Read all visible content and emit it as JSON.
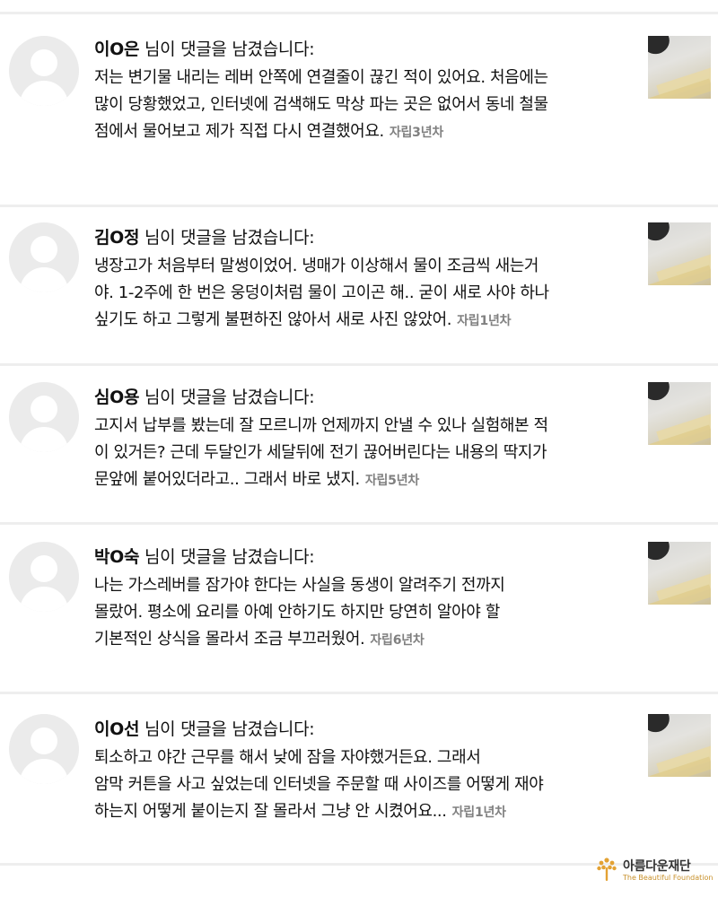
{
  "heading_suffix": "님이 댓글을 남겼습니다:",
  "comments": [
    {
      "name": "이O은",
      "lines": [
        "저는 변기물 내리는 레버 안쪽에 연결줄이 끊긴 적이 있어요. 처음에는",
        "많이 당황했었고, 인터넷에 검색해도 막상 파는 곳은 없어서 동네 철물",
        "점에서 물어보고 제가 직접 다시 연결했어요."
      ],
      "meta": "자립3년차"
    },
    {
      "name": "김O정",
      "lines": [
        "냉장고가 처음부터 말썽이었어. 냉매가 이상해서 물이 조금씩 새는거",
        "야. 1-2주에 한 번은 웅덩이처럼 물이 고이곤 해.. 굳이 새로 사야 하나",
        "싶기도 하고 그렇게 불편하진 않아서 새로 사진 않았어."
      ],
      "meta": "자립1년차"
    },
    {
      "name": "심O용",
      "lines": [
        "고지서 납부를 봤는데 잘 모르니까 언제까지 안낼 수 있나 실험해본 적",
        "이 있거든? 근데 두달인가 세달뒤에 전기 끊어버린다는 내용의 딱지가",
        "문앞에 붙어있더라고.. 그래서 바로 냈지."
      ],
      "meta": "자립5년차"
    },
    {
      "name": "박O숙",
      "lines": [
        "나는 가스레버를 잠가야 한다는 사실을 동생이 알려주기 전까지",
        "몰랐어. 평소에 요리를 아예 안하기도 하지만 당연히 알아야 할",
        "기본적인 상식을 몰라서 조금 부끄러웠어."
      ],
      "meta": "자립6년차"
    },
    {
      "name": "이O선",
      "lines": [
        "퇴소하고 야간 근무를 해서 낮에 잠을 자야했거든요. 그래서",
        "암막 커튼을 사고 싶었는데 인터넷을 주문할 때 사이즈를 어떻게 재야",
        "하는지 어떻게 붙이는지 잘 몰라서 그냥 안 시켰어요..."
      ],
      "meta": "자립1년차"
    }
  ],
  "logo": {
    "name": "아름다운재단",
    "subtitle": "The Beautiful Foundation",
    "color": "#e3a234"
  }
}
